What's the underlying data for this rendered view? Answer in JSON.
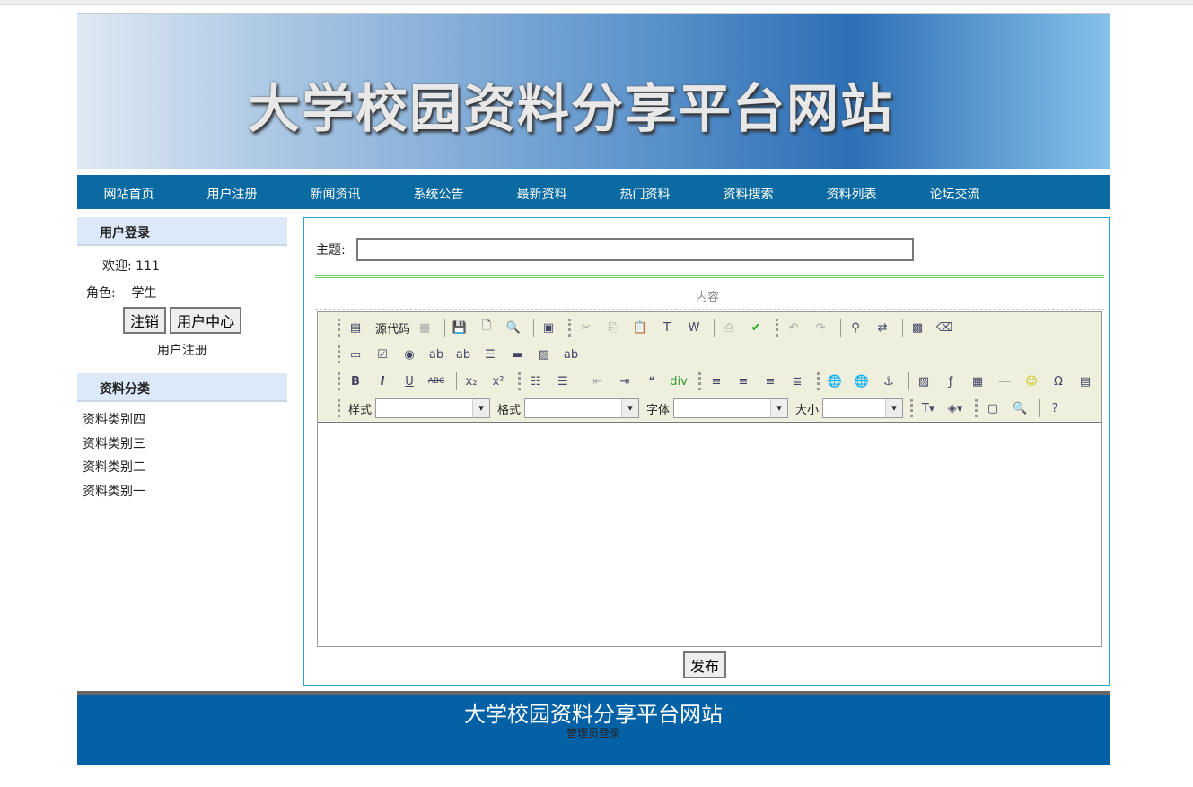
{
  "site_title": "大学校园资料分享平台网站",
  "nav": [
    "网站首页",
    "用户注册",
    "新闻资讯",
    "系统公告",
    "最新资料",
    "热门资料",
    "资料搜索",
    "资料列表",
    "论坛交流"
  ],
  "login": {
    "heading": "用户登录",
    "welcome": "欢迎: 111",
    "role_label": "角色:",
    "role": "学生",
    "logout": "注销",
    "user_center": "用户中心",
    "register": "用户注册"
  },
  "categories": {
    "heading": "资料分类",
    "items": [
      "资料类别四",
      "资料类别三",
      "资料类别二",
      "资料类别一"
    ]
  },
  "form": {
    "subject_label": "主题:",
    "subject_value": "",
    "content_label": "内容",
    "submit": "发布"
  },
  "editor": {
    "source_label": "源代码",
    "style_label": "样式",
    "format_label": "格式",
    "font_label": "字体",
    "size_label": "大小"
  },
  "footer": {
    "title": "大学校园资料分享平台网站",
    "admin_login": "管理员登录"
  }
}
